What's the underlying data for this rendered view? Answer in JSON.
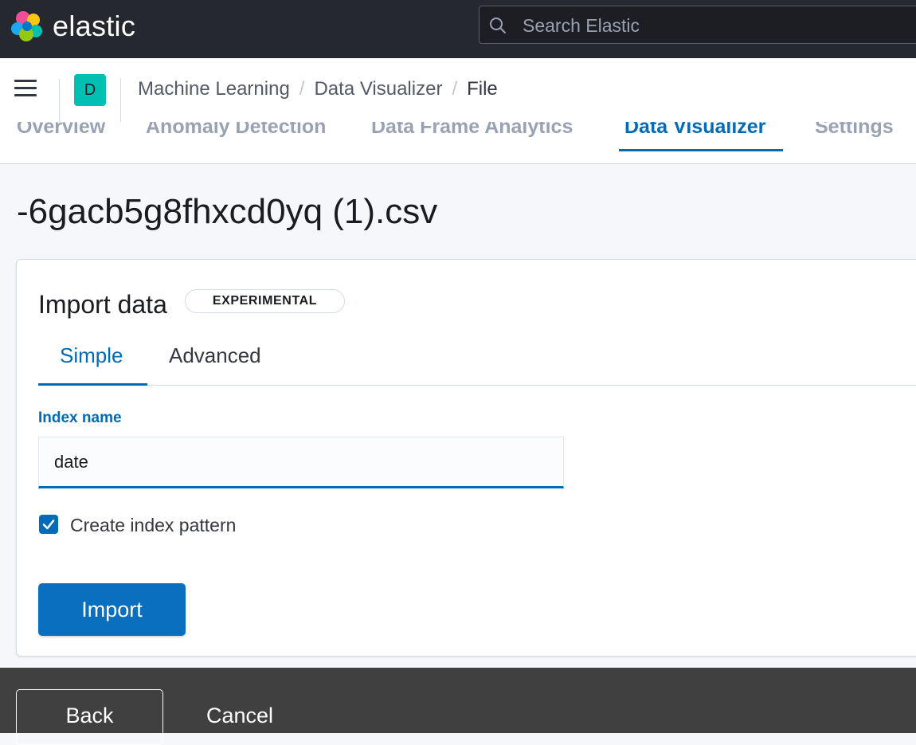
{
  "header": {
    "brand": "elastic",
    "search": {
      "placeholder": "Search Elastic",
      "value": ""
    }
  },
  "breadcrumbs": {
    "space_initial": "D",
    "items": [
      "Machine Learning",
      "Data Visualizer",
      "File"
    ]
  },
  "ml_tabs": [
    {
      "label": "Overview"
    },
    {
      "label": "Anomaly Detection"
    },
    {
      "label": "Data Frame Analytics"
    },
    {
      "label": "Data Visualizer",
      "active": true
    },
    {
      "label": "Settings"
    }
  ],
  "page": {
    "title": "-6gacb5g8fhxcd0yq (1).csv"
  },
  "import_panel": {
    "title": "Import data",
    "badge": "EXPERIMENTAL",
    "tabs": [
      {
        "label": "Simple",
        "active": true
      },
      {
        "label": "Advanced"
      }
    ],
    "index_name_label": "Index name",
    "index_name_value": "date",
    "create_index_pattern_label": "Create index pattern",
    "create_index_pattern_checked": true,
    "import_button": "Import"
  },
  "footer": {
    "back_button": "Back",
    "cancel_button": "Cancel"
  },
  "colors": {
    "header_bg": "#25282f",
    "accent": "#006bb8",
    "space_avatar": "#00bfb3",
    "footer_bg": "#404040"
  }
}
